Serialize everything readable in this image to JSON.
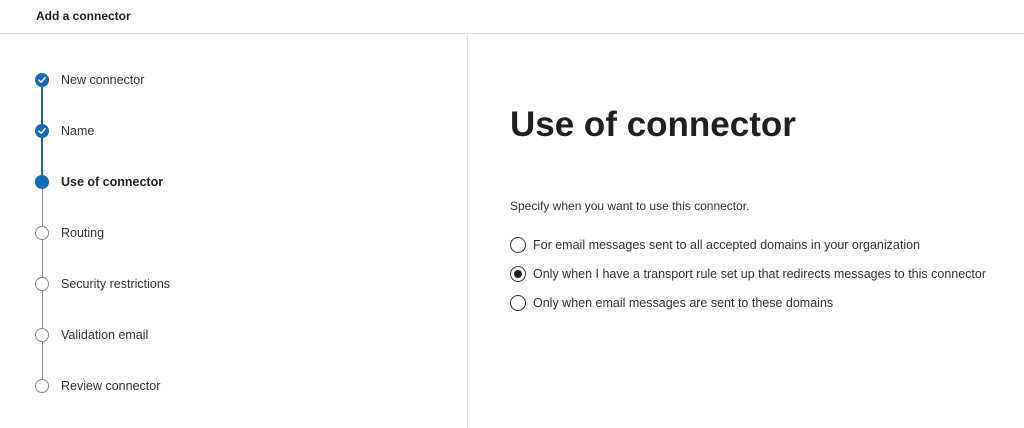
{
  "header": {
    "title": "Add a connector"
  },
  "steps": [
    {
      "label": "New connector",
      "state": "done"
    },
    {
      "label": "Name",
      "state": "done"
    },
    {
      "label": "Use of connector",
      "state": "current"
    },
    {
      "label": "Routing",
      "state": "todo"
    },
    {
      "label": "Security restrictions",
      "state": "todo"
    },
    {
      "label": "Validation email",
      "state": "todo"
    },
    {
      "label": "Review connector",
      "state": "todo"
    }
  ],
  "main": {
    "title": "Use of connector",
    "instruction": "Specify when you want to use this connector.",
    "options": [
      {
        "label": "For email messages sent to all accepted domains in your organization",
        "selected": false
      },
      {
        "label": "Only when I have a transport rule set up that redirects messages to this connector",
        "selected": true
      },
      {
        "label": "Only when email messages are sent to these domains",
        "selected": false
      }
    ]
  },
  "colors": {
    "accent": "#0f6cbd",
    "pending": "#8a8886",
    "text": "#323130"
  }
}
